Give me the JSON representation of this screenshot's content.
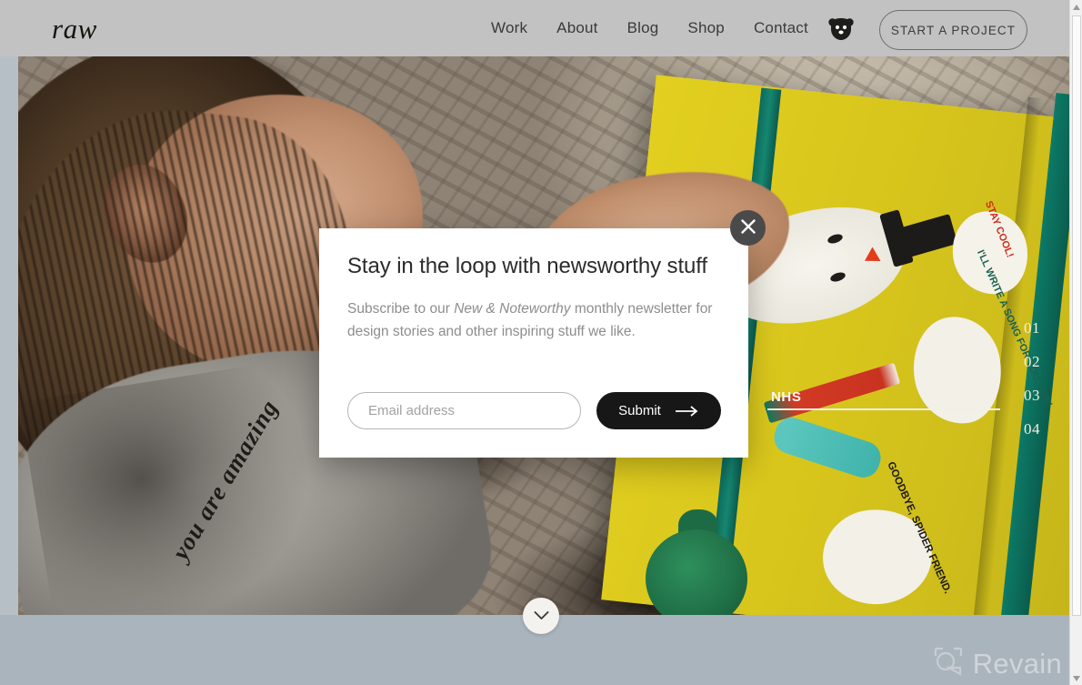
{
  "header": {
    "brand": "raw",
    "nav_items": [
      {
        "label": "Work"
      },
      {
        "label": "About"
      },
      {
        "label": "Blog"
      },
      {
        "label": "Shop"
      },
      {
        "label": "Contact"
      }
    ],
    "logo_icon": "bear-icon",
    "cta_label": "START A PROJECT",
    "background_color": "#c2c2c2"
  },
  "hero": {
    "alt": "Child lying on a patterned rug reading a yellow illustrated picture book",
    "sweater_text": "you are amazing",
    "book": {
      "page_color": "#d8c61d",
      "spine_color": "#0f7a66",
      "bubble_1_text": "STAY COOL!",
      "bubble_2_text": "I'LL WRITE A SONG FOR YOU, LEN!",
      "bubble_3_text": "GOODBYE, SPIDER FRIEND."
    },
    "slides": [
      {
        "number": "01",
        "label": "",
        "active": false
      },
      {
        "number": "02",
        "label": "",
        "active": false
      },
      {
        "number": "03",
        "label": "NHS",
        "active": true
      },
      {
        "number": "04",
        "label": "",
        "active": false
      }
    ],
    "scroll_down_icon": "chevron-down-icon"
  },
  "modal": {
    "title": "Stay in the loop with newsworthy stuff",
    "body_part_1": "Subscribe to our ",
    "body_italic": "New & Noteworthy",
    "body_part_2": " monthly newsletter for design stories and other inspiring stuff we like.",
    "email_placeholder": "Email address",
    "email_value": "",
    "submit_label": "Submit",
    "submit_icon": "arrow-right-icon",
    "close_icon": "close-icon",
    "background_color": "#ffffff",
    "submit_color": "#171717"
  },
  "watermark": {
    "text": "Revain",
    "icon": "camera-icon",
    "color": "#cfd5da"
  },
  "scrollbar": {
    "up_icon": "triangle-up-icon",
    "down_icon": "triangle-down-icon"
  }
}
